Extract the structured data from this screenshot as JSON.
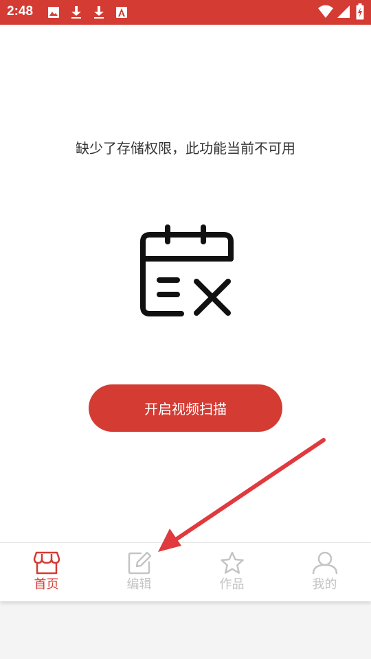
{
  "status_bar": {
    "time": "2:48",
    "background": "#d43b33",
    "left_icons": [
      "image-icon",
      "download-icon",
      "download-icon",
      "text-a-icon"
    ],
    "right_icons": [
      "wifi-icon",
      "signal-icon",
      "battery-charging-icon"
    ]
  },
  "main": {
    "message": "缺少了存储权限，此功能当前不可用",
    "illustration_icon": "calendar-x-icon",
    "action_button": "开启视频扫描"
  },
  "tabs": [
    {
      "label": "首页",
      "icon": "store-icon",
      "active": true
    },
    {
      "label": "编辑",
      "icon": "edit-icon",
      "active": false
    },
    {
      "label": "作品",
      "icon": "star-icon",
      "active": false
    },
    {
      "label": "我的",
      "icon": "user-icon",
      "active": false
    }
  ],
  "colors": {
    "accent": "#d43b33",
    "inactive": "#c4c4c4",
    "text": "#333333",
    "annotation_arrow": "#e0393e"
  }
}
